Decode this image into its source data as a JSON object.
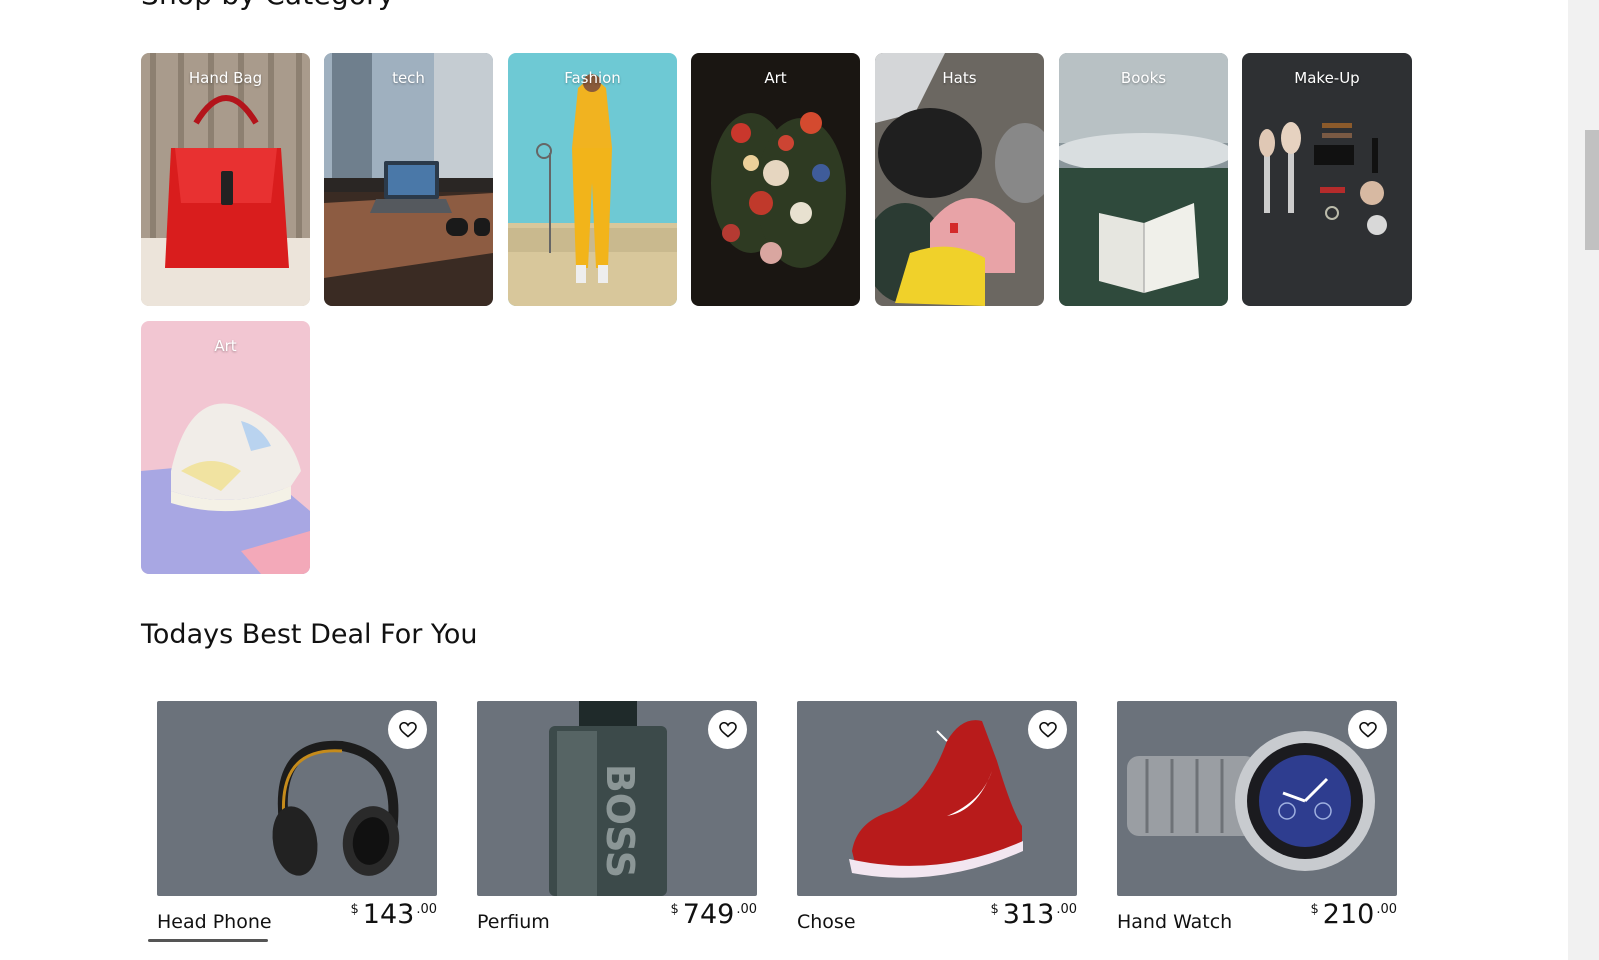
{
  "categories_section": {
    "title": "Shop by Category"
  },
  "categories": [
    {
      "label": "Hand Bag",
      "icon": "handbag-image"
    },
    {
      "label": "tech",
      "icon": "laptop-image"
    },
    {
      "label": "Fashion",
      "icon": "fashion-image"
    },
    {
      "label": "Art",
      "icon": "flowers-painting-image"
    },
    {
      "label": "Hats",
      "icon": "beanies-image"
    },
    {
      "label": "Books",
      "icon": "book-image"
    },
    {
      "label": "Make-Up",
      "icon": "makeup-image"
    },
    {
      "label": "Art",
      "icon": "sneaker-image"
    }
  ],
  "deals": {
    "title": "Todays Best Deal For You",
    "items": [
      {
        "name": "Head Phone",
        "currency": "$",
        "price_whole": "143",
        "price_cents": ".00",
        "icon": "headphones-image"
      },
      {
        "name": "Perfium",
        "currency": "$",
        "price_whole": "749",
        "price_cents": ".00",
        "icon": "perfume-bottle-image"
      },
      {
        "name": "Chose",
        "currency": "$",
        "price_whole": "313",
        "price_cents": ".00",
        "icon": "sneaker-image"
      },
      {
        "name": "Hand Watch",
        "currency": "$",
        "price_whole": "210",
        "price_cents": ".00",
        "icon": "watch-image"
      }
    ]
  },
  "colors": {
    "deal_card_bg": "#6b727b",
    "text": "#111111"
  }
}
